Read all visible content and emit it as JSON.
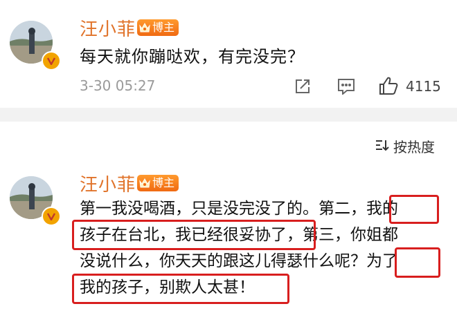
{
  "post1": {
    "username": "汪小菲",
    "badge_label": "博主",
    "text": "每天就你蹦哒欢，有完没完？",
    "timestamp": "3-30 05:27",
    "like_count": "4115"
  },
  "sort": {
    "label": "按热度"
  },
  "post2": {
    "username": "汪小菲",
    "badge_label": "博主",
    "line1a": "第一我没喝酒，只是没完没了的。第二，",
    "line1b": "我的",
    "line2a": "孩子在台北，我已经很妥协了",
    "line2b": "，第三，你姐都",
    "line3a": "没说什么，你天天的跟这儿得瑟什么呢？",
    "line3b": "为了",
    "line4": "我的孩子，别欺人太甚！"
  },
  "colors": {
    "username": "#e0732a",
    "highlight_box": "#d81e1e",
    "badge": "#f06a12",
    "verified": "#f2a300"
  }
}
